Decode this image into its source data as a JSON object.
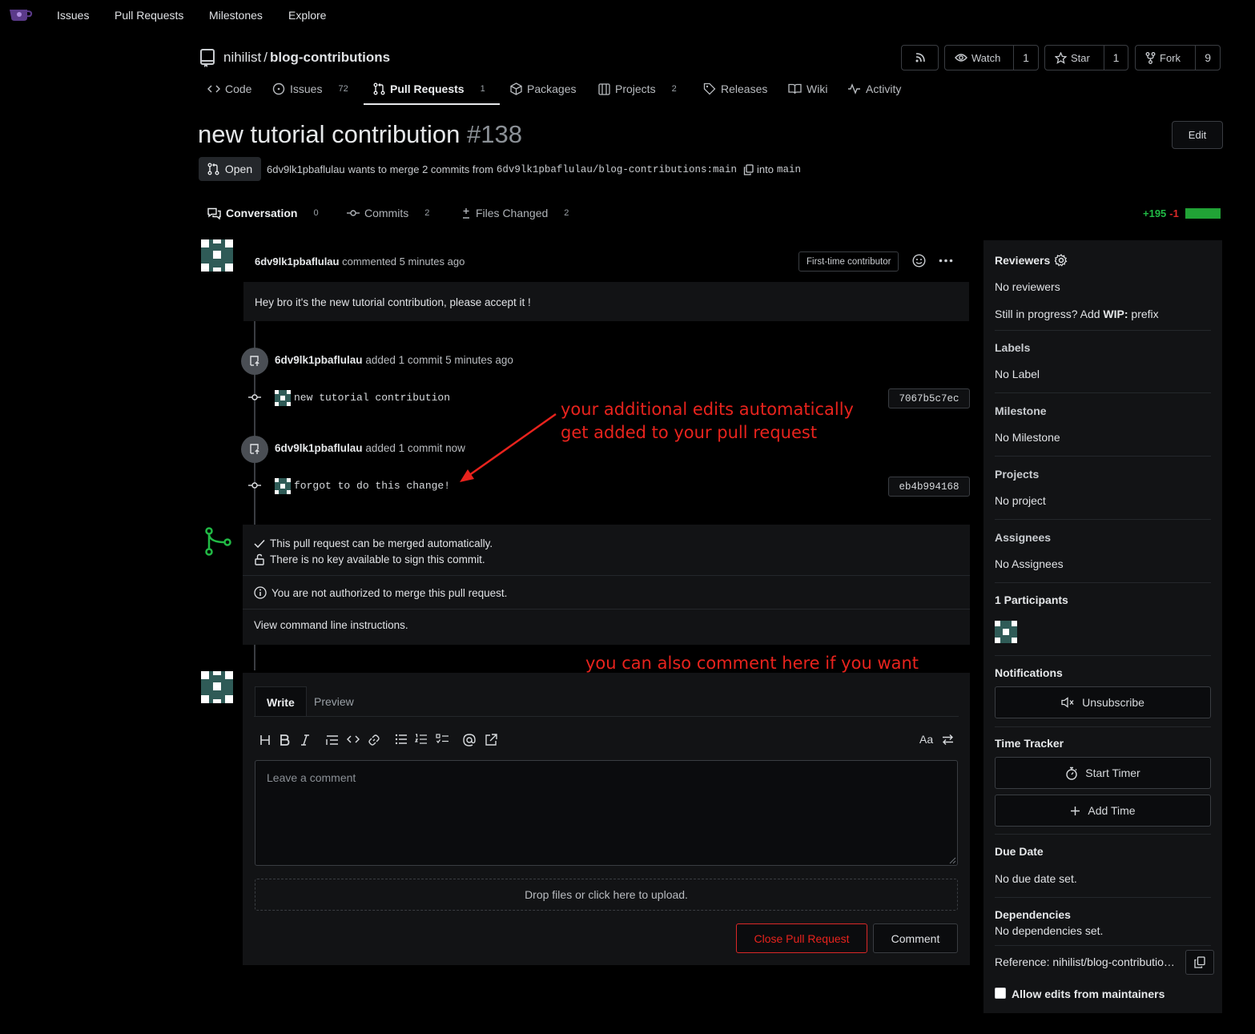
{
  "topnav": {
    "links": [
      "Issues",
      "Pull Requests",
      "Milestones",
      "Explore"
    ]
  },
  "repo": {
    "owner": "nihilist",
    "separator": "/",
    "name": "blog-contributions",
    "watch_label": "Watch",
    "watch_count": "1",
    "star_label": "Star",
    "star_count": "1",
    "fork_label": "Fork",
    "fork_count": "9"
  },
  "repo_tabs": [
    {
      "label": "Code",
      "count": ""
    },
    {
      "label": "Issues",
      "count": "72"
    },
    {
      "label": "Pull Requests",
      "count": "1"
    },
    {
      "label": "Packages",
      "count": ""
    },
    {
      "label": "Projects",
      "count": "2"
    },
    {
      "label": "Releases",
      "count": ""
    },
    {
      "label": "Wiki",
      "count": ""
    },
    {
      "label": "Activity",
      "count": ""
    }
  ],
  "pr": {
    "title": "new tutorial contribution",
    "number": "#138",
    "edit_label": "Edit",
    "state": "Open",
    "author": "6dv9lk1pbaflulau",
    "merge_text": "wants to merge 2 commits from",
    "head_branch": "6dv9lk1pbaflulau/blog-contributions:main",
    "into_text": "into",
    "base_branch": "main"
  },
  "pr_tabs": [
    {
      "label": "Conversation",
      "count": "0"
    },
    {
      "label": "Commits",
      "count": "2"
    },
    {
      "label": "Files Changed",
      "count": "2"
    }
  ],
  "diffstat": {
    "additions": "+195",
    "deletions": "-1"
  },
  "comment": {
    "author": "6dv9lk1pbaflulau",
    "action": "commented 5 minutes ago",
    "badge": "First-time contributor",
    "body": "Hey bro it's the new tutorial contribution, please accept it !"
  },
  "events": [
    {
      "author": "6dv9lk1pbaflulau",
      "text": "added 1 commit 5 minutes ago",
      "commit_msg": "new tutorial contribution",
      "sha": "7067b5c7ec"
    },
    {
      "author": "6dv9lk1pbaflulau",
      "text": "added 1 commit now",
      "commit_msg": "forgot to do this change!",
      "sha": "eb4b994168"
    }
  ],
  "merge_box": {
    "line1": "This pull request can be merged automatically.",
    "line2": "There is no key available to sign this commit.",
    "line3": "You are not authorized to merge this pull request.",
    "line4": "View command line instructions."
  },
  "annotations": {
    "first_line1": "your additional edits automatically",
    "first_line2": "get added to your pull request",
    "second": "you can also comment here if you want"
  },
  "editor": {
    "tab_write": "Write",
    "tab_preview": "Preview",
    "placeholder": "Leave a comment",
    "dropzone": "Drop files or click here to upload.",
    "close_label": "Close Pull Request",
    "comment_label": "Comment",
    "font_toggle": "Aa"
  },
  "sidebar": {
    "reviewers_title": "Reviewers",
    "reviewers_value": "No reviewers",
    "wip_prefix_text": "Still in progress? Add",
    "wip_bold": "WIP:",
    "wip_suffix": "prefix",
    "labels_title": "Labels",
    "labels_value": "No Label",
    "milestone_title": "Milestone",
    "milestone_value": "No Milestone",
    "projects_title": "Projects",
    "projects_value": "No project",
    "assignees_title": "Assignees",
    "assignees_value": "No Assignees",
    "participants_title": "1 Participants",
    "notifications_title": "Notifications",
    "unsubscribe_label": "Unsubscribe",
    "time_tracker_title": "Time Tracker",
    "start_timer_label": "Start Timer",
    "add_time_label": "Add Time",
    "due_date_title": "Due Date",
    "due_date_value": "No due date set.",
    "dependencies_title": "Dependencies",
    "dependencies_value": "No dependencies set.",
    "reference": "Reference: nihilist/blog-contributio…",
    "allow_edits": "Allow edits from maintainers"
  },
  "colors": {
    "accent_green": "#21ba45",
    "accent_red": "#db2828",
    "annotation_red": "#e8231d",
    "background": "#000000",
    "panel": "#121315"
  }
}
